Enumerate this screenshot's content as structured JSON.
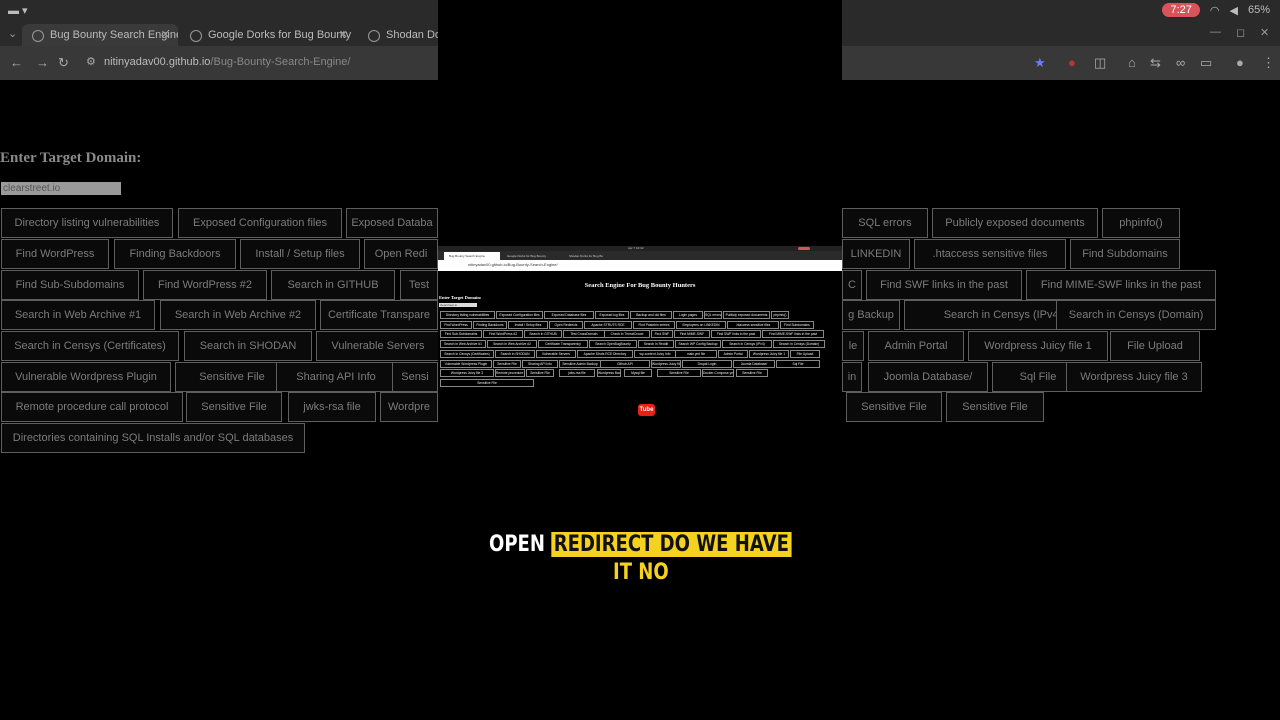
{
  "background": {
    "status_time": "7:27",
    "battery": "65%",
    "tabs": [
      {
        "label": "Bug Bounty Search Engine",
        "active": true
      },
      {
        "label": "Google Dorks for Bug Bounty",
        "active": false
      },
      {
        "label": "Shodan Dorks",
        "active": false
      }
    ],
    "url_host": "nitinyadav00.github.io",
    "url_path": "/Bug-Bounty-Search-Engine/",
    "heading": "Enter Target Domain:",
    "input_value": "clearstreet.io",
    "buttons": [
      "Directory listing vulnerabilities",
      "Exposed Configuration files",
      "Exposed Databa",
      "SQL errors",
      "Publicly exposed documents",
      "phpinfo()",
      "Find WordPress",
      "Finding Backdoors",
      "Install / Setup files",
      "Open Redi",
      "LINKEDIN",
      ".htaccess sensitive files",
      "Find Subdomains",
      "Find Sub-Subdomains",
      "Find WordPress #2",
      "Search in GITHUB",
      "Test",
      "C",
      "Find SWF links in the past",
      "Find MIME-SWF links in the past",
      "Search in Web Archive #1",
      "Search in Web Archive #2",
      "Certificate Transpare",
      "g Backup",
      "Search in Censys (IPv4)",
      "Search in Censys (Domain)",
      "Search in Censys (Certificates)",
      "Search in SHODAN",
      "Vulnerable Servers",
      "le",
      "Admin Portal",
      "Wordpress Juicy file 1",
      "File Upload",
      "Vulnerable Wordpress Plugin",
      "Sensitive File",
      "Sharing API Info",
      "Sensi",
      "in",
      "Joomla Database/",
      "Sql File",
      "Wordpress Juicy file 3",
      "Remote procedure call protocol",
      "Sensitive File",
      "jwks-rsa file",
      "Wordpre",
      "Sensitive File",
      "Sensitive File",
      "Directories containing SQL Installs and/or SQL databases"
    ]
  },
  "inner": {
    "status_time": "Apr 7  10:32",
    "tabs": [
      "Bug Bounty Search Engine",
      "Google Dorks for Bug Bounty",
      "Shodan Dorks for Bug Bo"
    ],
    "url": "nitinyadav00.github.io/Bug-Bounty-Search-Engine/",
    "title": "Search Engine For Bug Bounty Hunters",
    "enter_label": "Enter Target Domain:",
    "input_value": "clearstreet.io",
    "buttons": [
      "Directory listing vulnerabilities",
      "Exposed Configuration files",
      "Exposed Database files",
      "Exposed log files",
      "Backup and old files",
      "Login pages",
      "SQL errors",
      "Publicly exposed documents",
      "phpinfo()",
      "Find WordPress",
      "Finding Backdoors",
      "Install / Setup files",
      "Open Redirects",
      "Apache STRUTS RCE",
      "Find Pastebin entries",
      "Employees on LINKEDIN",
      ".htaccess sensitive files",
      "Find Subdomains",
      "Find Sub-Subdomains",
      "Find WordPress #2",
      "Search in GITHUB",
      "Test CrossDomain",
      "Check in ThreatCrowd",
      "Find SWF",
      "Find MIME-SWF",
      "Find SWF links in the past",
      "Find MIME-SWF links in the past",
      "Search in Web Archive #1",
      "Search in Web Archive #2",
      "Certificate Transparency",
      "Search OpenBugBounty",
      "Search in Reddit",
      "Search WP Config Backup",
      "Search in Censys (IPv4)",
      "Search in Censys (Domain)",
      "Search in Censys (Certificates)",
      "Search in SHODAN",
      "Vulnerable Servers",
      "Apache Struts RCE Directory",
      "wp-content Juicy Info",
      "main.yml file",
      "Admin Portal",
      "Wordpress Juicy file 1",
      "File Upload",
      "Vulnerable Wordpress Plugin",
      "Sensitive File",
      "Sharing API Info",
      "Sensitive Admin Backup",
      "Github API",
      "Wordpress Juicy file 2",
      "Drupal Login",
      "Joomla Database/",
      "Sql File",
      "Wordpress Juicy file 3",
      "Remote procedure call protocol",
      "Sensitive File",
      "jwks-rsa file",
      "Wordpress Backup",
      "Mysql file",
      "Sensitive File",
      "Docker-Compose yml file",
      "Sensitive File",
      "Sensitive File",
      "Directories containing SQL Installs and/or SQL databases"
    ]
  },
  "youtube_logo": "Tube",
  "caption": {
    "line1_white": "OPEN",
    "line1_highlight": "REDIRECT DO WE HAVE",
    "line2": "IT NO"
  },
  "colors": {
    "caption_yellow": "#f5d21f",
    "record_red": "#d9545a",
    "youtube_red": "#e62117"
  }
}
